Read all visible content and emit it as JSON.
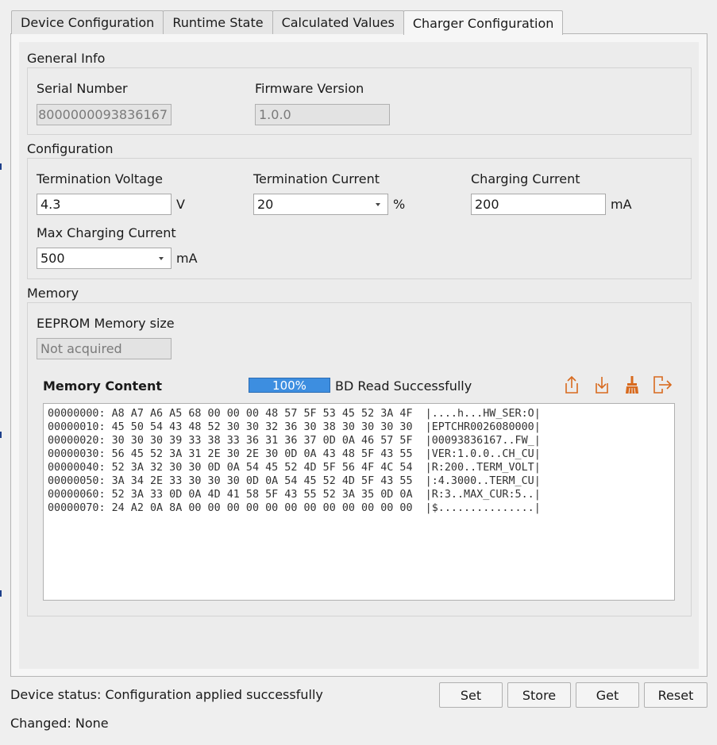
{
  "tabs": [
    {
      "label": "Device Configuration",
      "active": false
    },
    {
      "label": "Runtime State",
      "active": false
    },
    {
      "label": "Calculated Values",
      "active": false
    },
    {
      "label": "Charger Configuration",
      "active": true
    }
  ],
  "general_info": {
    "title": "General Info",
    "serial_label": "Serial Number",
    "serial_value": "8000000093836167",
    "firmware_label": "Firmware Version",
    "firmware_value": "1.0.0"
  },
  "configuration": {
    "title": "Configuration",
    "term_voltage_label": "Termination Voltage",
    "term_voltage_value": "4.3",
    "term_voltage_unit": "V",
    "term_current_label": "Termination Current",
    "term_current_value": "20",
    "term_current_unit": "%",
    "charging_current_label": "Charging Current",
    "charging_current_value": "200",
    "charging_current_unit": "mA",
    "max_charging_label": "Max Charging Current",
    "max_charging_value": "500",
    "max_charging_unit": "mA"
  },
  "memory": {
    "title": "Memory",
    "eeprom_label": "EEPROM Memory size",
    "eeprom_placeholder": "Not acquired",
    "content_label": "Memory Content",
    "progress_value": 100,
    "progress_text": "100%",
    "read_status": "BD Read Successfully",
    "icons": [
      "export-icon",
      "import-icon",
      "clear-icon",
      "exit-icon"
    ],
    "hex_dump": "00000000: A8 A7 A6 A5 68 00 00 00 48 57 5F 53 45 52 3A 4F  |....h...HW_SER:O|\n00000010: 45 50 54 43 48 52 30 30 32 36 30 38 30 30 30 30  |EPTCHR0026080000|\n00000020: 30 30 30 39 33 38 33 36 31 36 37 0D 0A 46 57 5F  |00093836167..FW_|\n00000030: 56 45 52 3A 31 2E 30 2E 30 0D 0A 43 48 5F 43 55  |VER:1.0.0..CH_CU|\n00000040: 52 3A 32 30 30 0D 0A 54 45 52 4D 5F 56 4F 4C 54  |R:200..TERM_VOLT|\n00000050: 3A 34 2E 33 30 30 30 0D 0A 54 45 52 4D 5F 43 55  |:4.3000..TERM_CU|\n00000060: 52 3A 33 0D 0A 4D 41 58 5F 43 55 52 3A 35 0D 0A  |R:3..MAX_CUR:5..|\n00000070: 24 A2 0A 8A 00 00 00 00 00 00 00 00 00 00 00 00  |$...............|"
  },
  "footer": {
    "device_status": "Device status: Configuration applied successfully",
    "changed": "Changed: None",
    "buttons": {
      "set": "Set",
      "store": "Store",
      "get": "Get",
      "reset": "Reset"
    }
  },
  "colors": {
    "accent": "#3d8ee0",
    "icon": "#d86a1e"
  }
}
